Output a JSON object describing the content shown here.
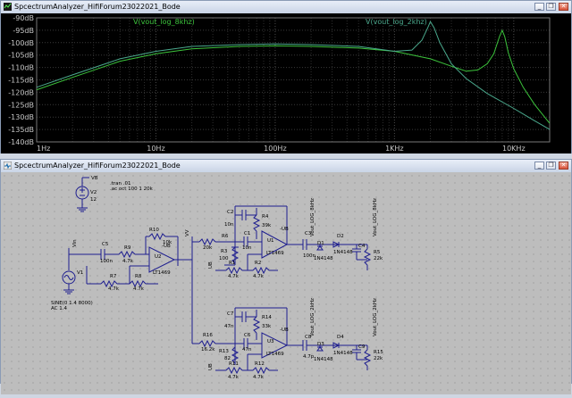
{
  "top_window": {
    "title": "SpcectrumAnalyzer_HifiForum23022021_Bode",
    "buttons": {
      "minimize": "_",
      "restore": "❐",
      "close": "✕"
    }
  },
  "bottom_window": {
    "title": "SpcectrumAnalyzer_HifiForum23022021_Bode",
    "buttons": {
      "minimize": "_",
      "restore": "❐",
      "close": "✕"
    }
  },
  "chart_data": {
    "type": "line",
    "x_scale": "log",
    "x_range_hz": [
      1,
      20000
    ],
    "y_range_db": [
      -140,
      -90
    ],
    "grid": true,
    "x_ticks": [
      "1Hz",
      "10Hz",
      "100Hz",
      "1KHz",
      "10KHz"
    ],
    "y_ticks": [
      "-90dB",
      "-95dB",
      "-100dB",
      "-105dB",
      "-110dB",
      "-115dB",
      "-120dB",
      "-125dB",
      "-130dB",
      "-135dB",
      "-140dB"
    ],
    "series": [
      {
        "name": "V(vout_log_8khz)",
        "color": "#3cc43c",
        "x": [
          1,
          2,
          5,
          10,
          20,
          50,
          100,
          200,
          500,
          1000,
          2000,
          3000,
          4000,
          5000,
          6000,
          6800,
          7600,
          8000,
          8400,
          9000,
          10000,
          12000,
          15000,
          20000
        ],
        "y": [
          -119,
          -114,
          -107.5,
          -104.5,
          -102.5,
          -101.5,
          -101.3,
          -101.5,
          -102.2,
          -103.5,
          -106.5,
          -109.5,
          -111.5,
          -111,
          -108.5,
          -104.5,
          -97.5,
          -95,
          -97.5,
          -104,
          -110.5,
          -118,
          -125,
          -132.5
        ]
      },
      {
        "name": "V(vout_log_2khz)",
        "color": "#4aa88c",
        "x": [
          1,
          2,
          5,
          10,
          20,
          50,
          100,
          200,
          500,
          1000,
          1400,
          1700,
          1900,
          2000,
          2150,
          2400,
          3000,
          4000,
          6000,
          10000,
          15000,
          20000
        ],
        "y": [
          -118,
          -113,
          -106.5,
          -103.5,
          -101.5,
          -100.8,
          -100.5,
          -100.8,
          -101.5,
          -103.5,
          -103,
          -99,
          -94,
          -91.5,
          -94,
          -100,
          -108.5,
          -114.5,
          -120.5,
          -126.5,
          -131.5,
          -135
        ]
      }
    ]
  },
  "schematic": {
    "directives": [
      ".tran .01",
      ".ac oct 100 1 20k"
    ],
    "source": {
      "ref": "V1",
      "value1": "SINE(0 1.4 8000)",
      "value2": "AC 1.4"
    },
    "supply": {
      "ref": "V2",
      "value": "12",
      "net": "VB"
    },
    "nets": [
      "Vin",
      "VV",
      "Vout_LOG_8kHz",
      "Vout_LOG_2kHz",
      "VB",
      "-UB",
      "UB"
    ],
    "components": [
      {
        "ref": "C5",
        "value": "100n"
      },
      {
        "ref": "R9",
        "value": "4.7k"
      },
      {
        "ref": "R10",
        "value": "10k"
      },
      {
        "ref": "U2",
        "value": "LT1469"
      },
      {
        "ref": "R7",
        "value": "4.7k"
      },
      {
        "ref": "R8",
        "value": "4.7k"
      },
      {
        "ref": "R6",
        "value": "20k"
      },
      {
        "ref": "C2",
        "value": "10n"
      },
      {
        "ref": "R4",
        "value": "39k"
      },
      {
        "ref": "C1",
        "value": "10n"
      },
      {
        "ref": "R3",
        "value": "100"
      },
      {
        "ref": "U1",
        "value": "LT1469"
      },
      {
        "ref": "R1",
        "value": "4.7k"
      },
      {
        "ref": "R2",
        "value": "4.7k"
      },
      {
        "ref": "C3",
        "value": "100n"
      },
      {
        "ref": "D1",
        "value": "1N4148"
      },
      {
        "ref": "D2",
        "value": "1N4148"
      },
      {
        "ref": "C4",
        "value": "1µ"
      },
      {
        "ref": "R5",
        "value": "22k"
      },
      {
        "ref": "R16",
        "value": "16.2k"
      },
      {
        "ref": "C7",
        "value": "47n"
      },
      {
        "ref": "R14",
        "value": "33k"
      },
      {
        "ref": "C6",
        "value": "47n"
      },
      {
        "ref": "R13",
        "value": "82"
      },
      {
        "ref": "U3",
        "value": "LT1469"
      },
      {
        "ref": "R11",
        "value": "4.7k"
      },
      {
        "ref": "R12",
        "value": "4.7k"
      },
      {
        "ref": "C8",
        "value": "4.7p"
      },
      {
        "ref": "D3",
        "value": "1N4148"
      },
      {
        "ref": "D4",
        "value": "1N4148"
      },
      {
        "ref": "C9",
        "value": "1µ"
      },
      {
        "ref": "R15",
        "value": "22k"
      }
    ],
    "power_labels": {
      "vb": "VB",
      "ub_pos": "UB",
      "ub_neg": "-UB"
    }
  }
}
